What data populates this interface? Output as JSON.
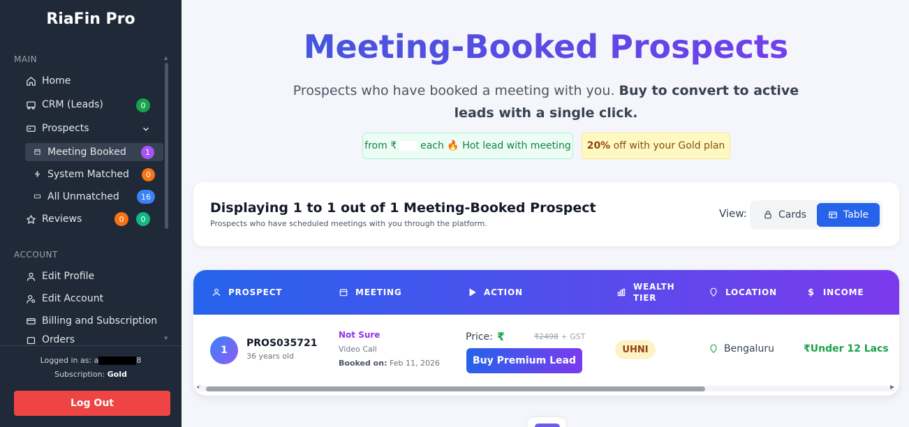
{
  "sidebar": {
    "brand": "RiaFin Pro",
    "section_main": "MAIN",
    "section_account": "ACCOUNT",
    "home": "Home",
    "crm": "CRM (Leads)",
    "crm_badge": "0",
    "prospects": "Prospects",
    "meeting_booked": "Meeting Booked",
    "meeting_booked_badge": "1",
    "system_matched": "System Matched",
    "system_matched_badge": "0",
    "all_unmatched": "All Unmatched",
    "all_unmatched_badge": "16",
    "reviews": "Reviews",
    "reviews_badge_1": "0",
    "reviews_badge_2": "0",
    "edit_profile": "Edit Profile",
    "edit_account": "Edit Account",
    "billing": "Billing and Subscription",
    "orders": "Orders",
    "logged_in_label": "Logged in as:",
    "logged_in_user_prefix": "a",
    "logged_in_user_suffix": "8",
    "subscription_label": "Subscription:",
    "subscription_value": "Gold",
    "logout": "Log Out"
  },
  "hero": {
    "title": "Meeting-Booked Prospects",
    "subtitle_plain": "Prospects who have booked a meeting with you. ",
    "subtitle_bold": "Buy to convert to active leads with a single click.",
    "pill_from": "from ₹",
    "pill_each": "each 🔥 Hot lead with meeting",
    "pill_discount_bold": "20%",
    "pill_discount_rest": " off with your Gold plan"
  },
  "summary": {
    "title": "Displaying 1 to 1 out of 1 Meeting-Booked Prospect",
    "subtitle": "Prospects who have scheduled meetings with you through the platform.",
    "view_label": "View:",
    "cards_label": "Cards",
    "table_label": "Table"
  },
  "table": {
    "headers": {
      "prospect": "PROSPECT",
      "meeting": "MEETING",
      "action": "ACTION",
      "wealth_1": "WEALTH",
      "wealth_2": "TIER",
      "location": "LOCATION",
      "income": "INCOME"
    },
    "rows": [
      {
        "index": "1",
        "id": "PROS035721",
        "age": "36 years old",
        "meeting_status": "Not Sure",
        "meeting_type": "Video Call",
        "booked_label": "Booked on:",
        "booked_date": "Feb 11, 2026",
        "price_label": "Price:",
        "price_symbol": "₹",
        "old_price": "₹2498",
        "gst": "+ GST",
        "buy_label": "Buy Premium Lead",
        "wealth_tier": "UHNI",
        "location": "Bengaluru",
        "income": "₹Under 12 Lacs"
      }
    ]
  },
  "colors": {
    "sidebar_bg": "#1f2937",
    "accent_blue": "#2563eb",
    "accent_purple": "#7c3aed",
    "badge_green": "#16a34a",
    "badge_purple": "#a855f7",
    "badge_orange": "#f97316",
    "badge_blue": "#3b82f6",
    "logout_red": "#ef4444"
  }
}
